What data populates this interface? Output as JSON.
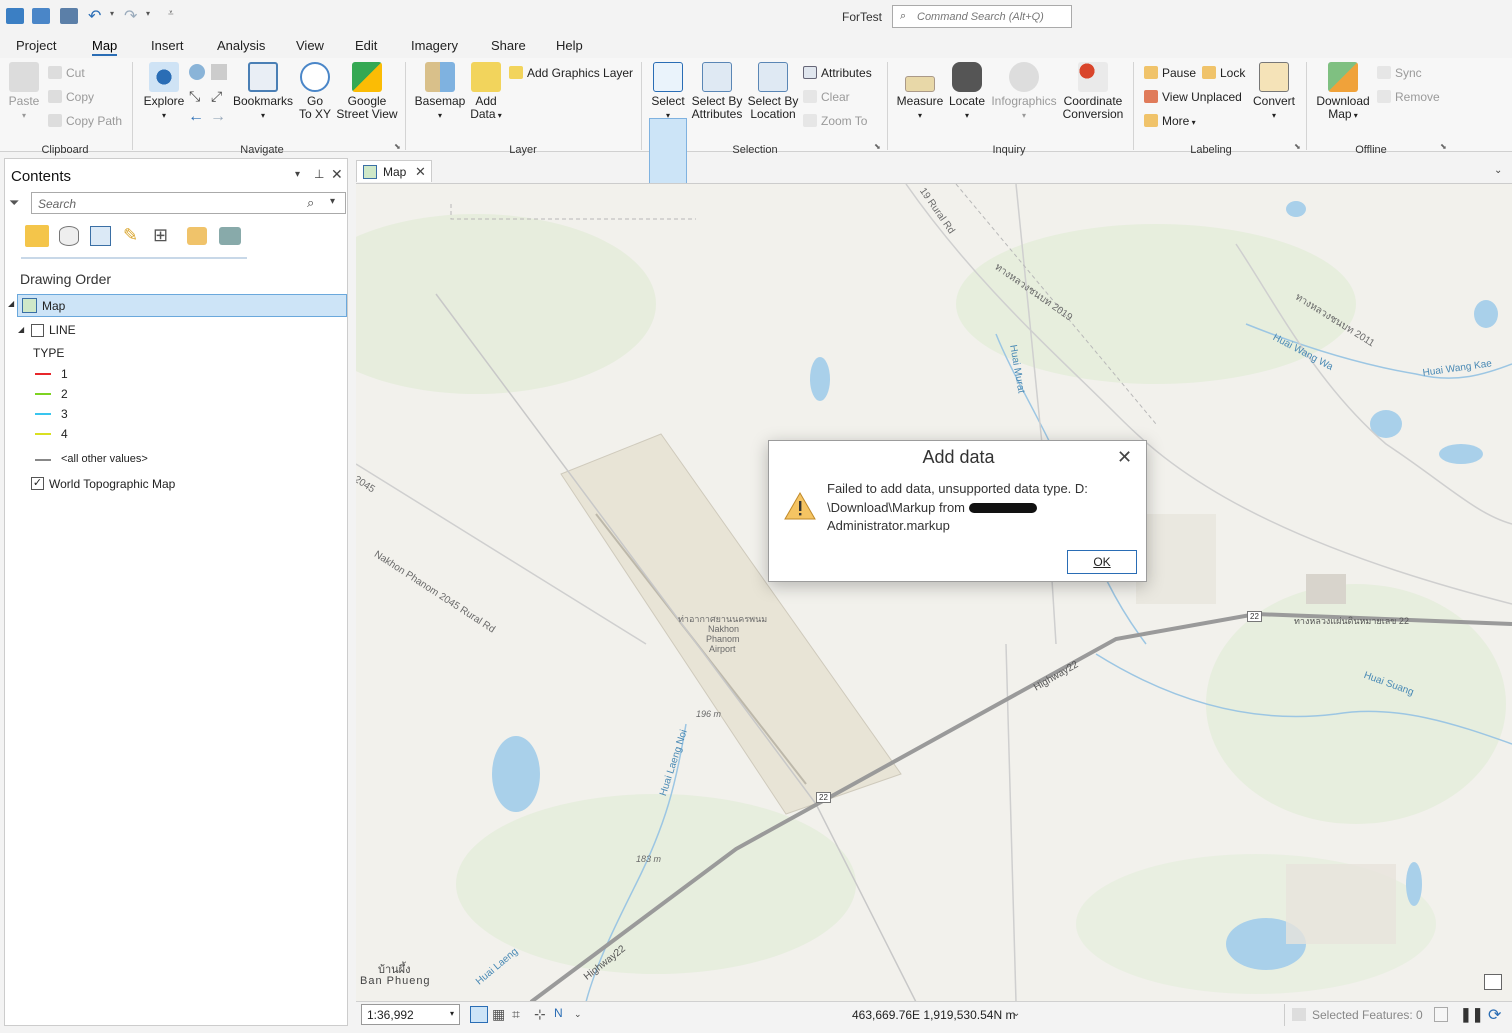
{
  "app": {
    "title": "ForTest"
  },
  "command_search": {
    "placeholder": "Command Search (Alt+Q)"
  },
  "ribbon_tabs": [
    "Project",
    "Map",
    "Insert",
    "Analysis",
    "View",
    "Edit",
    "Imagery",
    "Share",
    "Help"
  ],
  "ribbon": {
    "clipboard": {
      "paste": "Paste",
      "cut": "Cut",
      "copy": "Copy",
      "copy_path": "Copy Path",
      "group": "Clipboard"
    },
    "navigate": {
      "explore": "Explore",
      "bookmarks": "Bookmarks",
      "goto_xy_1": "Go",
      "goto_xy_2": "To XY",
      "google_1": "Google",
      "google_2": "Street View",
      "group": "Navigate"
    },
    "layer": {
      "basemap": "Basemap",
      "add_data_1": "Add",
      "add_data_2": "Data",
      "add_graphics": "Add Graphics Layer",
      "group": "Layer"
    },
    "selection": {
      "select": "Select",
      "by_attr_1": "Select By",
      "by_attr_2": "Attributes",
      "by_loc_1": "Select By",
      "by_loc_2": "Location",
      "attributes": "Attributes",
      "clear": "Clear",
      "zoom_to": "Zoom To",
      "group": "Selection"
    },
    "inquiry": {
      "measure": "Measure",
      "locate": "Locate",
      "infographics": "Infographics",
      "coord_1": "Coordinate",
      "coord_2": "Conversion",
      "group": "Inquiry"
    },
    "labeling": {
      "pause": "Pause",
      "lock": "Lock",
      "view_unplaced": "View Unplaced",
      "more": "More",
      "convert": "Convert",
      "group": "Labeling"
    },
    "offline": {
      "download_1": "Download",
      "download_2": "Map",
      "sync": "Sync",
      "remove": "Remove",
      "group": "Offline"
    }
  },
  "contents": {
    "title": "Contents",
    "search_placeholder": "Search",
    "drawing_order": "Drawing Order",
    "map_item": "Map",
    "layer_line": "LINE",
    "type_label": "TYPE",
    "legend": [
      {
        "label": "1",
        "color": "#e8262b"
      },
      {
        "label": "2",
        "color": "#7ed321"
      },
      {
        "label": "3",
        "color": "#39c5ef"
      },
      {
        "label": "4",
        "color": "#d9e021"
      }
    ],
    "other_values": "<all other values>",
    "other_color": "#888888",
    "basemap_layer": "World Topographic Map"
  },
  "map_tab": {
    "label": "Map"
  },
  "map_labels": {
    "airport_th": "ท่าอากาศยานนครพนม",
    "airport_1": "Nakhon",
    "airport_2": "Phanom",
    "airport_3": "Airport",
    "elev1": "196 m",
    "elev2": "183 m",
    "road_2045": "Nakhon Phanom 2045 Rural Rd",
    "road_2045_num": "2045",
    "highway22": "Highway22",
    "highway22b": "Highway22",
    "hwy_shield": "22",
    "hwy_shield2": "22",
    "ban_phueng_th": "บ้านผึ้ง",
    "ban_phueng": "Ban Phueng",
    "huai_wang_wa": "Huai Wang Wa",
    "huai_wang_kae": "Huai Wang Kae",
    "huai_suang": "Huai Suang",
    "huai_laeng_noi": "Huai Laeng Noi",
    "huai_laeng": "Huai Laeng",
    "rural_rd_top": "19 Rural Rd",
    "hwy_2019": "ทางหลวงชนบท 2019",
    "hwy_2011": "ทางหลวงชนบท 2011",
    "huai_murat": "Huai Murat",
    "hwy22_th": "ทางหลวงแผ่นดินหมายเลข 22"
  },
  "status": {
    "scale": "1:36,992",
    "coordinates": "463,669.76E 1,919,530.54N m",
    "selected_features": "Selected Features: 0"
  },
  "dialog": {
    "title": "Add data",
    "message_line1": "Failed to add data, unsupported data type. D:",
    "message_line2_prefix": "\\Download\\Markup from",
    "message_line3": "Administrator.markup",
    "ok": "OK",
    "close_glyph": "✕"
  }
}
